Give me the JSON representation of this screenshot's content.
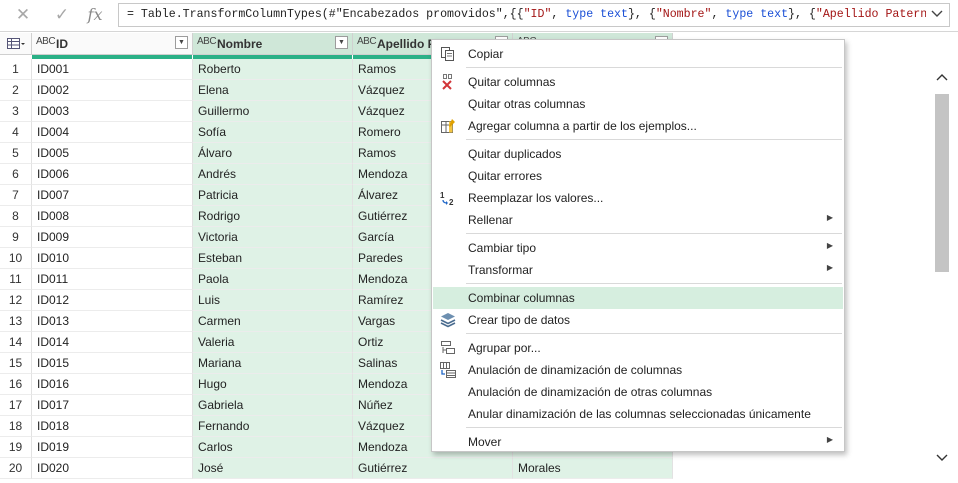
{
  "formula_bar": {
    "cancel_icon": "close-icon",
    "confirm_icon": "check-icon",
    "fx_label": "fx",
    "formula_parts": [
      {
        "text": "= Table.TransformColumnTypes(#\"Encabezados promovidos\",{{",
        "style": "plain"
      },
      {
        "text": "\"ID\"",
        "style": "str"
      },
      {
        "text": ", ",
        "style": "plain"
      },
      {
        "text": "type text",
        "style": "kw"
      },
      {
        "text": "}, {",
        "style": "plain"
      },
      {
        "text": "\"Nombre\"",
        "style": "str"
      },
      {
        "text": ", ",
        "style": "plain"
      },
      {
        "text": "type text",
        "style": "kw"
      },
      {
        "text": "}, {",
        "style": "plain"
      },
      {
        "text": "\"Apellido Paterno\"",
        "style": "str"
      },
      {
        "text": ",",
        "style": "plain"
      }
    ],
    "expand_icon": "chevron-down-icon"
  },
  "grid": {
    "type_icon_label": "ABC",
    "columns": [
      {
        "name": "ID",
        "selected": false
      },
      {
        "name": "Nombre",
        "selected": true
      },
      {
        "name": "Apellido Pa",
        "selected": true
      },
      {
        "name": "",
        "selected": true
      }
    ],
    "rows": [
      {
        "n": "1",
        "cells": [
          "ID001",
          "Roberto",
          "Ramos",
          ""
        ]
      },
      {
        "n": "2",
        "cells": [
          "ID002",
          "Elena",
          "Vázquez",
          ""
        ]
      },
      {
        "n": "3",
        "cells": [
          "ID003",
          "Guillermo",
          "Vázquez",
          ""
        ]
      },
      {
        "n": "4",
        "cells": [
          "ID004",
          "Sofía",
          "Romero",
          ""
        ]
      },
      {
        "n": "5",
        "cells": [
          "ID005",
          "Álvaro",
          "Ramos",
          ""
        ]
      },
      {
        "n": "6",
        "cells": [
          "ID006",
          "Andrés",
          "Mendoza",
          ""
        ]
      },
      {
        "n": "7",
        "cells": [
          "ID007",
          "Patricia",
          "Álvarez",
          ""
        ]
      },
      {
        "n": "8",
        "cells": [
          "ID008",
          "Rodrigo",
          "Gutiérrez",
          ""
        ]
      },
      {
        "n": "9",
        "cells": [
          "ID009",
          "Victoria",
          "García",
          ""
        ]
      },
      {
        "n": "10",
        "cells": [
          "ID010",
          "Esteban",
          "Paredes",
          ""
        ]
      },
      {
        "n": "11",
        "cells": [
          "ID011",
          "Paola",
          "Mendoza",
          ""
        ]
      },
      {
        "n": "12",
        "cells": [
          "ID012",
          "Luis",
          "Ramírez",
          ""
        ]
      },
      {
        "n": "13",
        "cells": [
          "ID013",
          "Carmen",
          "Vargas",
          ""
        ]
      },
      {
        "n": "14",
        "cells": [
          "ID014",
          "Valeria",
          "Ortiz",
          ""
        ]
      },
      {
        "n": "15",
        "cells": [
          "ID015",
          "Mariana",
          "Salinas",
          ""
        ]
      },
      {
        "n": "16",
        "cells": [
          "ID016",
          "Hugo",
          "Mendoza",
          ""
        ]
      },
      {
        "n": "17",
        "cells": [
          "ID017",
          "Gabriela",
          "Núñez",
          ""
        ]
      },
      {
        "n": "18",
        "cells": [
          "ID018",
          "Fernando",
          "Vázquez",
          ""
        ]
      },
      {
        "n": "19",
        "cells": [
          "ID019",
          "Carlos",
          "Mendoza",
          ""
        ]
      },
      {
        "n": "20",
        "cells": [
          "ID020",
          "José",
          "Gutiérrez",
          "Morales"
        ]
      }
    ]
  },
  "context_menu": {
    "items": [
      {
        "label": "Copiar",
        "icon": "copy-icon",
        "submenu": false
      },
      {
        "sep": true
      },
      {
        "label": "Quitar columnas",
        "icon": "remove-columns-icon",
        "submenu": false
      },
      {
        "label": "Quitar otras columnas",
        "icon": "",
        "submenu": false
      },
      {
        "label": "Agregar columna a partir de los ejemplos...",
        "icon": "column-from-examples-icon",
        "submenu": false
      },
      {
        "sep": true
      },
      {
        "label": "Quitar duplicados",
        "icon": "",
        "submenu": false
      },
      {
        "label": "Quitar errores",
        "icon": "",
        "submenu": false
      },
      {
        "label": "Reemplazar los valores...",
        "icon": "replace-values-icon",
        "submenu": false
      },
      {
        "label": "Rellenar",
        "icon": "",
        "submenu": true
      },
      {
        "sep": true
      },
      {
        "label": "Cambiar tipo",
        "icon": "",
        "submenu": true
      },
      {
        "label": "Transformar",
        "icon": "",
        "submenu": true
      },
      {
        "sep": true
      },
      {
        "label": "Combinar columnas",
        "icon": "",
        "submenu": false,
        "hover": true
      },
      {
        "label": "Crear tipo de datos",
        "icon": "data-type-icon",
        "submenu": false
      },
      {
        "sep": true
      },
      {
        "label": "Agrupar por...",
        "icon": "group-by-icon",
        "submenu": false
      },
      {
        "label": "Anulación de dinamización de columnas",
        "icon": "unpivot-icon",
        "submenu": false
      },
      {
        "label": "Anulación de dinamización de otras columnas",
        "icon": "",
        "submenu": false
      },
      {
        "label": "Anular dinamización de las columnas seleccionadas únicamente",
        "icon": "",
        "submenu": false
      },
      {
        "sep": true
      },
      {
        "label": "Mover",
        "icon": "",
        "submenu": true
      }
    ]
  },
  "scrollbar": {
    "up_icon": "chevron-up-icon",
    "down_icon": "chevron-down-icon"
  }
}
